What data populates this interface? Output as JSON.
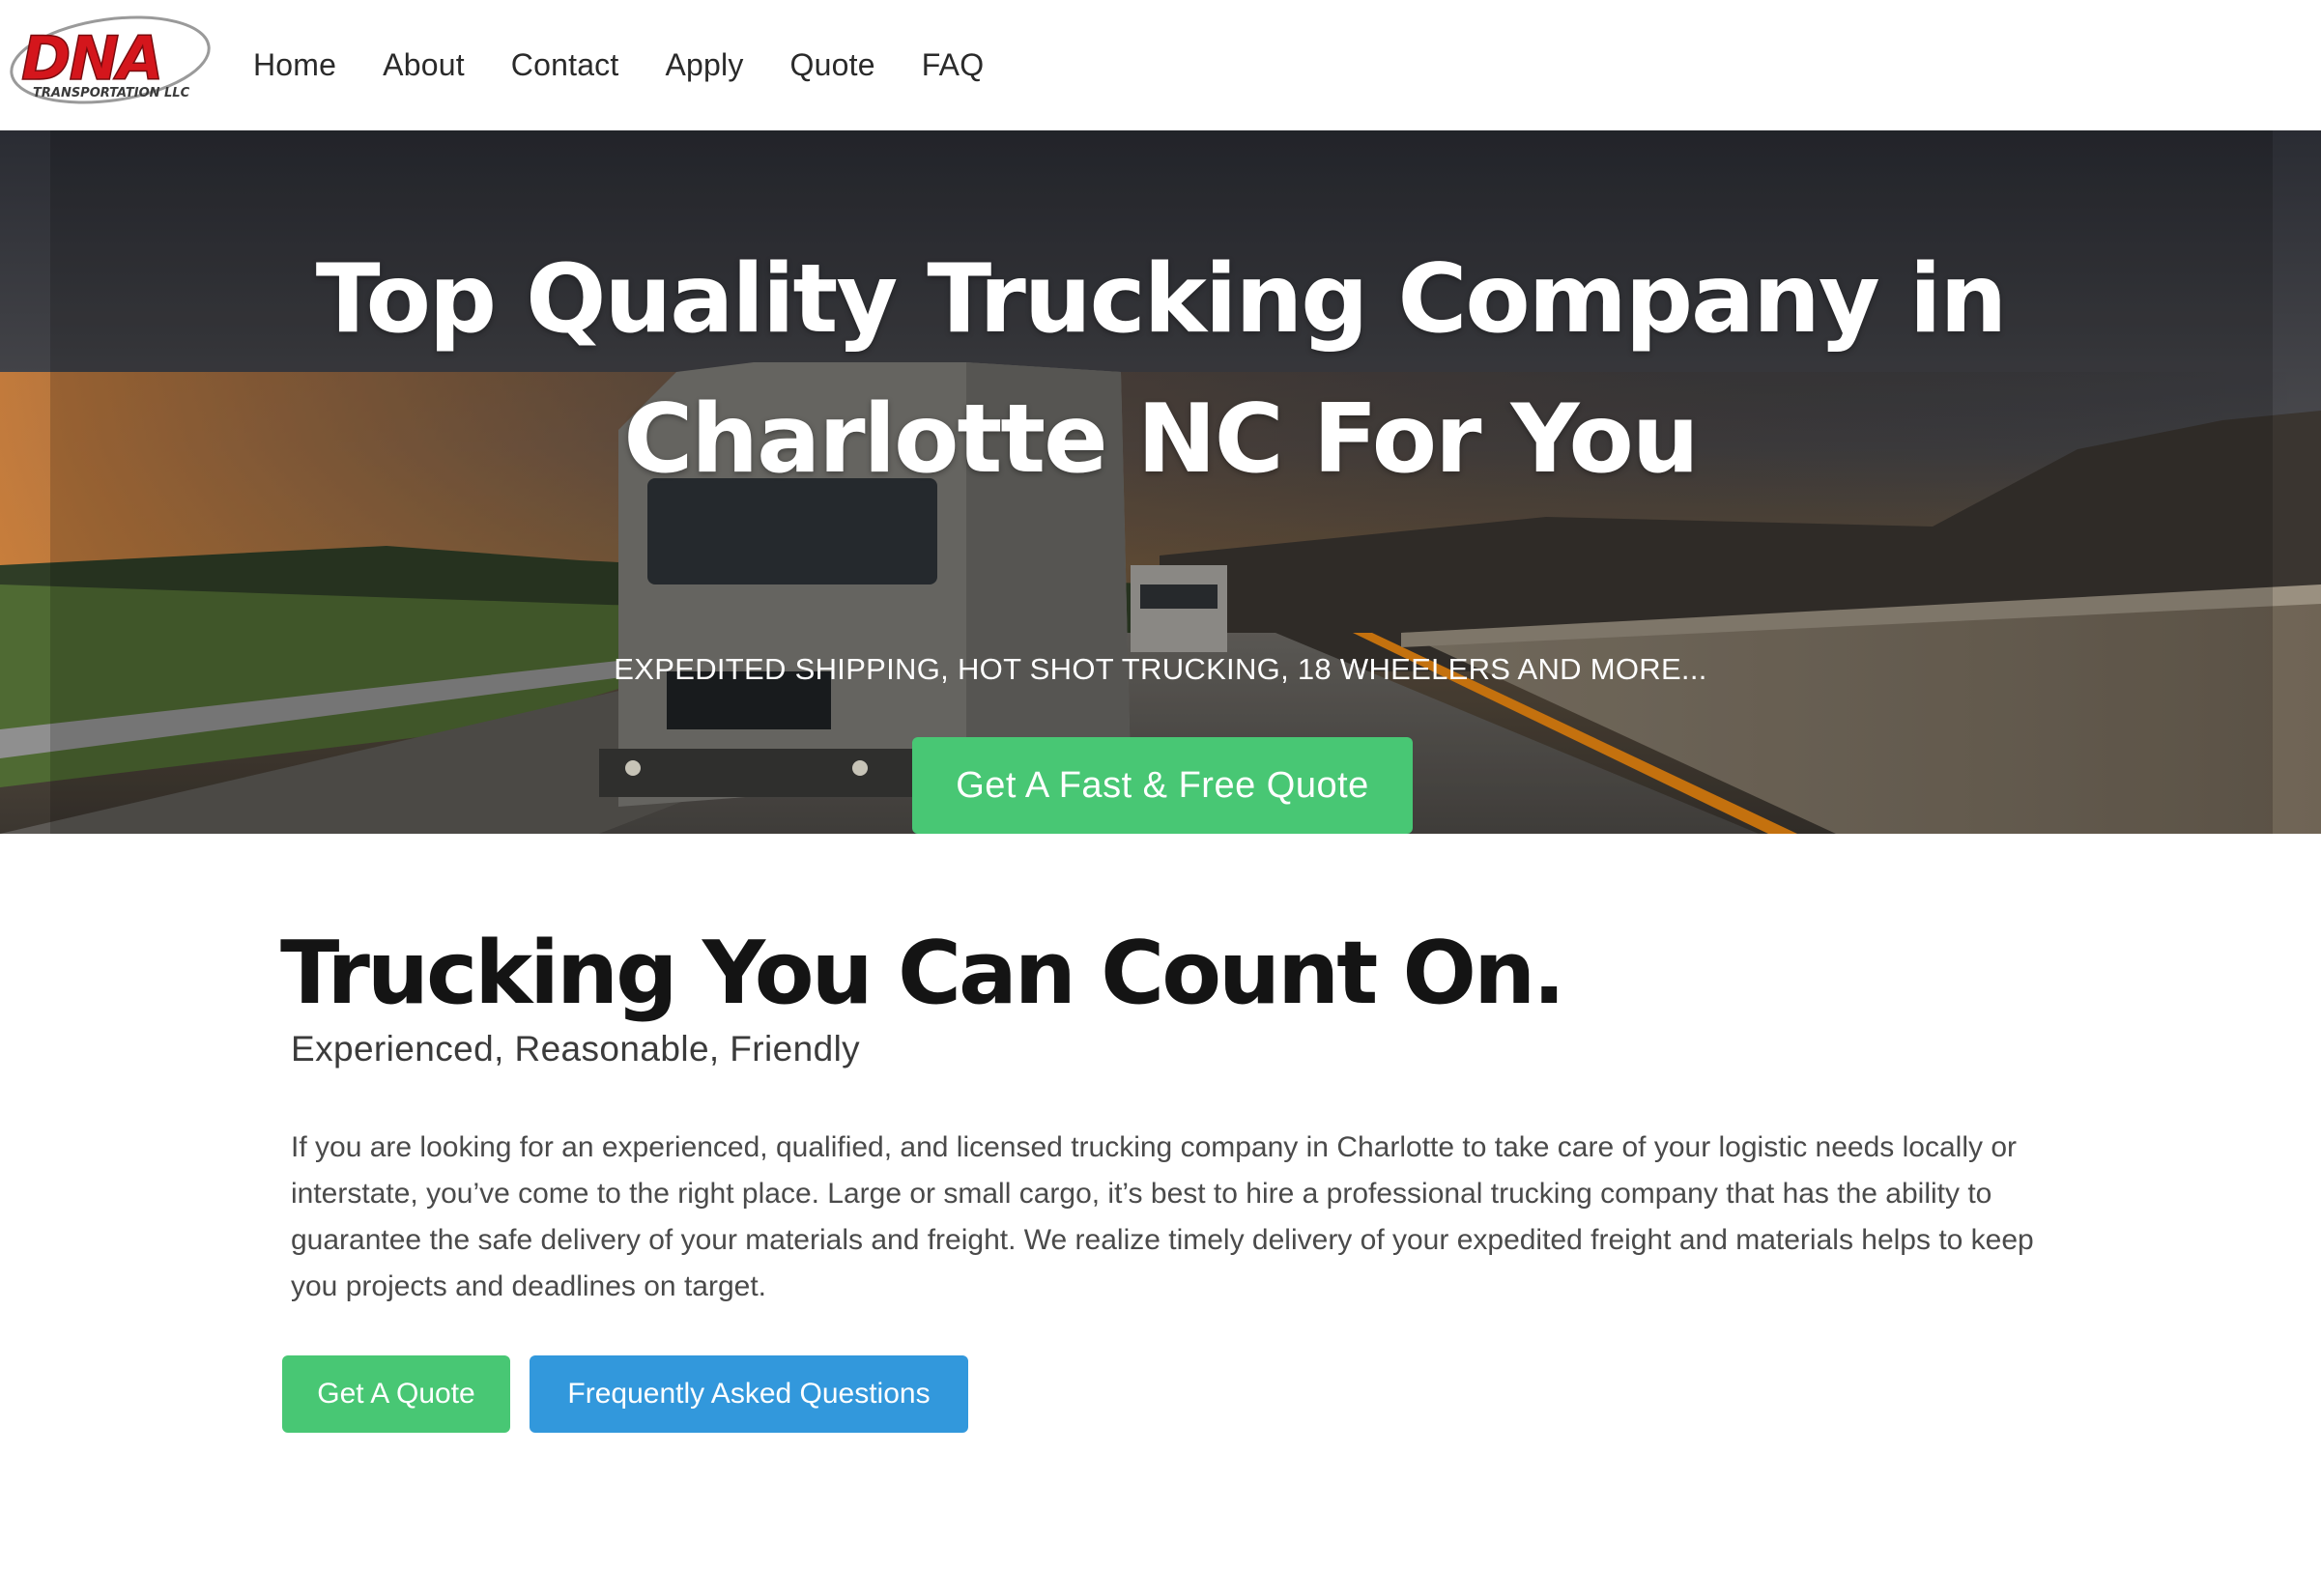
{
  "brand": {
    "logo_text": "DNA",
    "logo_subtext": "TRANSPORTATION LLC"
  },
  "nav": {
    "items": [
      {
        "label": "Home"
      },
      {
        "label": "About"
      },
      {
        "label": "Contact"
      },
      {
        "label": "Apply"
      },
      {
        "label": "Quote"
      },
      {
        "label": "FAQ"
      }
    ]
  },
  "hero": {
    "title": "Top Quality Trucking Company in Charlotte NC For You",
    "subtitle": "EXPEDITED SHIPPING, HOT SHOT TRUCKING, 18 WHEELERS AND MORE...",
    "cta_label": "Get A Fast & Free Quote"
  },
  "section": {
    "title": "Trucking You Can Count On.",
    "subtitle": "Experienced, Reasonable, Friendly",
    "body": "If you are looking for an experienced, qualified, and licensed trucking company in Charlotte to take care of your logistic needs locally or interstate, you’ve come to the right place. Large or small cargo, it’s best to hire a professional trucking company that has the ability to guarantee the safe delivery of your materials and freight. We realize timely delivery of your expedited freight and materials helps to keep you projects and deadlines on target.",
    "quote_button_label": "Get A Quote",
    "faq_button_label": "Frequently Asked Questions"
  },
  "colors": {
    "green": "#48c774",
    "blue": "#3298dc",
    "logo_red": "#d4161c"
  }
}
